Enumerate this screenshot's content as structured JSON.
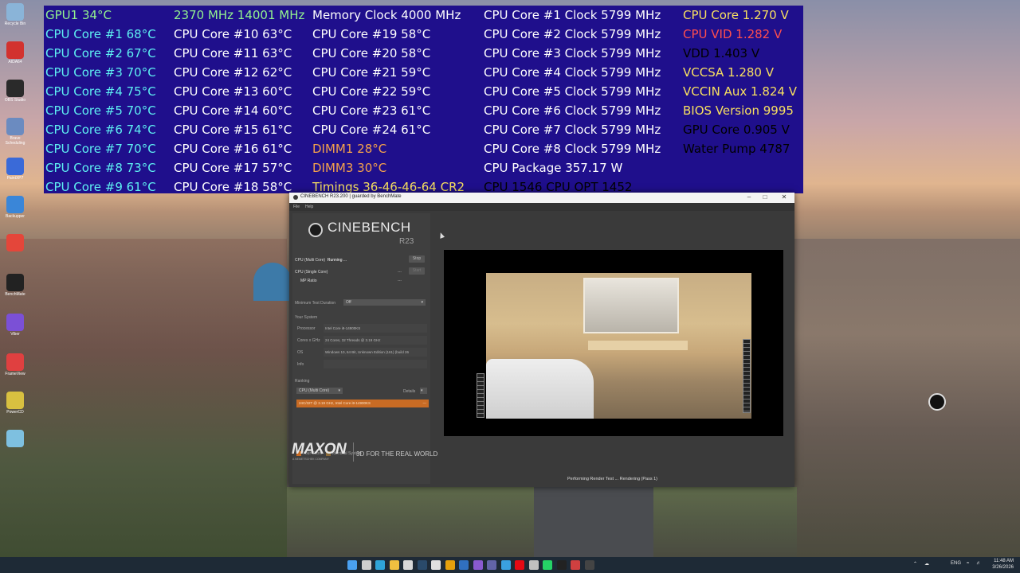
{
  "colors": {
    "osd_bg": "#1f0f8c",
    "osd_green": "#93f38f",
    "osd_cyan": "#5ef0f2",
    "osd_white": "#ffffff",
    "osd_orange": "#f4a14c",
    "osd_yellow": "#f8e060",
    "osd_red": "#ff4e4e",
    "osd_lightblue": "#5fc9ef",
    "rank_bar": "#c86b24",
    "taskbar": "#1e2a36"
  },
  "desktop_icons": [
    {
      "label": "Recycle Bin",
      "icon": "recycle-bin-icon",
      "color": "#8ab4d8"
    },
    {
      "label": "AIDA64",
      "icon": "aida64-icon",
      "color": "#d2322e"
    },
    {
      "label": "OBS Studio",
      "icon": "obs-studio-icon",
      "color": "#2a2a2a"
    },
    {
      "label": "Brave Scheduling",
      "icon": "app-icon",
      "color": "#6b8bc0"
    },
    {
      "label": "PaintXP7",
      "icon": "paint-icon",
      "color": "#3a6ad8"
    },
    {
      "label": "Backupper",
      "icon": "backup-icon",
      "color": "#3a86d8"
    },
    {
      "label": "",
      "icon": "chrome-icon",
      "color": "#e4463a"
    },
    {
      "label": "BenchMate",
      "icon": "benchmate-icon",
      "color": "#222222"
    },
    {
      "label": "Viber",
      "icon": "viber-icon",
      "color": "#7b50d6"
    },
    {
      "label": "FrameView",
      "icon": "frameview-icon",
      "color": "#e04040"
    },
    {
      "label": "PowerCD",
      "icon": "powercd-icon",
      "color": "#d8c040"
    },
    {
      "label": "",
      "icon": "folder-icon",
      "color": "#7ec0e0"
    }
  ],
  "osd": {
    "col1": [
      {
        "text": "GPU1 34°C",
        "color": "green"
      },
      {
        "text": "CPU Core #1 68°C",
        "color": "cyan"
      },
      {
        "text": "CPU Core #2 67°C",
        "color": "cyan"
      },
      {
        "text": "CPU Core #3 70°C",
        "color": "cyan"
      },
      {
        "text": "CPU Core #4 75°C",
        "color": "cyan"
      },
      {
        "text": "CPU Core #5 70°C",
        "color": "cyan"
      },
      {
        "text": "CPU Core #6 74°C",
        "color": "cyan"
      },
      {
        "text": "CPU Core #7 70°C",
        "color": "cyan"
      },
      {
        "text": "CPU Core #8 73°C",
        "color": "cyan"
      },
      {
        "text": "CPU Core #9 61°C",
        "color": "cyan"
      }
    ],
    "col2": [
      {
        "text": "2370 MHz  14001 MHz",
        "color": "green"
      },
      {
        "text": "CPU Core #10 63°C",
        "color": "white"
      },
      {
        "text": "CPU Core #11 63°C",
        "color": "white"
      },
      {
        "text": "CPU Core #12 62°C",
        "color": "white"
      },
      {
        "text": "CPU Core #13 60°C",
        "color": "white"
      },
      {
        "text": "CPU Core #14 60°C",
        "color": "white"
      },
      {
        "text": "CPU Core #15 61°C",
        "color": "white"
      },
      {
        "text": "CPU Core #16 61°C",
        "color": "white"
      },
      {
        "text": "CPU Core #17 57°C",
        "color": "white"
      },
      {
        "text": "CPU Core #18 58°C",
        "color": "white"
      }
    ],
    "col3": [
      {
        "text": "Memory Clock 4000 MHz",
        "color": "white"
      },
      {
        "text": "CPU Core #19 58°C",
        "color": "white"
      },
      {
        "text": "CPU Core #20 58°C",
        "color": "white"
      },
      {
        "text": "CPU Core #21 59°C",
        "color": "white"
      },
      {
        "text": "CPU Core #22 59°C",
        "color": "white"
      },
      {
        "text": "CPU Core #23 61°C",
        "color": "white"
      },
      {
        "text": "CPU Core #24 61°C",
        "color": "white"
      },
      {
        "text": "DIMM1 28°C",
        "color": "orange"
      },
      {
        "text": "DIMM3 30°C",
        "color": "orange"
      },
      {
        "text": "Timings 36-46-46-64 CR2",
        "color": "yellow"
      }
    ],
    "col4": [
      {
        "text": "CPU Core #1 Clock 5799 MHz",
        "color": "white"
      },
      {
        "text": "CPU Core #2 Clock 5799 MHz",
        "color": "white"
      },
      {
        "text": "CPU Core #3 Clock 5799 MHz",
        "color": "white"
      },
      {
        "text": "CPU Core #4 Clock 5799 MHz",
        "color": "white"
      },
      {
        "text": "CPU Core #5 Clock 5799 MHz",
        "color": "white"
      },
      {
        "text": "CPU Core #6 Clock 5799 MHz",
        "color": "white"
      },
      {
        "text": "CPU Core #7 Clock 5799 MHz",
        "color": "white"
      },
      {
        "text": "CPU Core #8 Clock 5799 MHz",
        "color": "white"
      },
      {
        "text": "CPU Package 357.17 W",
        "color": "white"
      },
      {
        "text": "CPU 1546   CPU OPT 1452",
        "color": "lightblue"
      }
    ],
    "col5": [
      {
        "text": "CPU Core 1.270 V",
        "color": "yellow"
      },
      {
        "text": "CPU VID 1.282 V",
        "color": "red"
      },
      {
        "text": "VDD 1.403 V",
        "color": "lightblue"
      },
      {
        "text": "VCCSA 1.280 V",
        "color": "yellow"
      },
      {
        "text": "VCCIN Aux 1.824 V",
        "color": "yellow"
      },
      {
        "text": "BIOS Version 9995",
        "color": "yellow"
      },
      {
        "text": "GPU Core 0.905 V",
        "color": "lightblue"
      },
      {
        "text": "Water Pump 4787",
        "color": "lightblue"
      }
    ]
  },
  "cinebench": {
    "window_title": "CINEBENCH R23.200 | guarded by BenchMate",
    "menu": [
      "File",
      "Help"
    ],
    "logo_text": "CINEBENCH",
    "logo_version": "R23",
    "tests": {
      "multi_label": "CPU (Multi Core)",
      "multi_status": "Running ...",
      "stop_label": "Stop",
      "single_label": "CPU (Single Core)",
      "single_value": "---",
      "start_label": "Start",
      "mp_label": "MP Ratio",
      "mp_value": "---"
    },
    "min_duration_label": "Minimum Test Duration",
    "min_duration_value": "Off",
    "your_system_label": "Your System",
    "system": [
      {
        "key": "Processor",
        "value": "Intel Core i9-14900KS"
      },
      {
        "key": "Cores x GHz",
        "value": "24 Cores, 32 Threads @ 3.19 GHz"
      },
      {
        "key": "OS",
        "value": "Windows 10, 64 Bit, Unknown Edition (161) (build 26"
      },
      {
        "key": "Info",
        "value": ""
      }
    ],
    "ranking_label": "Ranking",
    "ranking_select": "CPU (Multi Core)",
    "details_label": "Details",
    "rank_entry": "24C/32T @ 3.19 GHz, Intel Core i9-14900KS",
    "rank_score": "---",
    "legend_your_score": "Your Score",
    "legend_identical": "Identical System",
    "maxon": "MAXON",
    "maxon_sub": "A NEMETSCHEK COMPANY",
    "tagline": "3D FOR THE REAL WORLD",
    "status": "Performing Render Test ... Rendering (Pass 1)"
  },
  "taskbar": {
    "icons": [
      {
        "icon": "windows-start-icon",
        "color": "#4aa0f0"
      },
      {
        "icon": "search-icon",
        "color": "#cfcfcf"
      },
      {
        "icon": "edge-icon",
        "color": "#2fa4d8"
      },
      {
        "icon": "file-explorer-icon",
        "color": "#f0c040"
      },
      {
        "icon": "notepad-icon",
        "color": "#d8d8d8"
      },
      {
        "icon": "steam-icon",
        "color": "#2a4a6a"
      },
      {
        "icon": "app-icon",
        "color": "#e0e0e0"
      },
      {
        "icon": "plex-icon",
        "color": "#e5a00d"
      },
      {
        "icon": "app-icon",
        "color": "#3070c0"
      },
      {
        "icon": "visual-studio-icon",
        "color": "#8a5ad0"
      },
      {
        "icon": "teams-icon",
        "color": "#6264a7"
      },
      {
        "icon": "photos-icon",
        "color": "#3aa0e0"
      },
      {
        "icon": "netflix-icon",
        "color": "#e50914"
      },
      {
        "icon": "app-icon",
        "color": "#c0c0c0"
      },
      {
        "icon": "whatsapp-icon",
        "color": "#25d366"
      },
      {
        "icon": "benchmate-icon",
        "color": "#222222"
      },
      {
        "icon": "app-icon",
        "color": "#d04040"
      },
      {
        "icon": "cinebench-icon",
        "color": "#444444"
      }
    ],
    "language": "ENG",
    "time": "11:48 AM",
    "date": "3/26/2026"
  }
}
